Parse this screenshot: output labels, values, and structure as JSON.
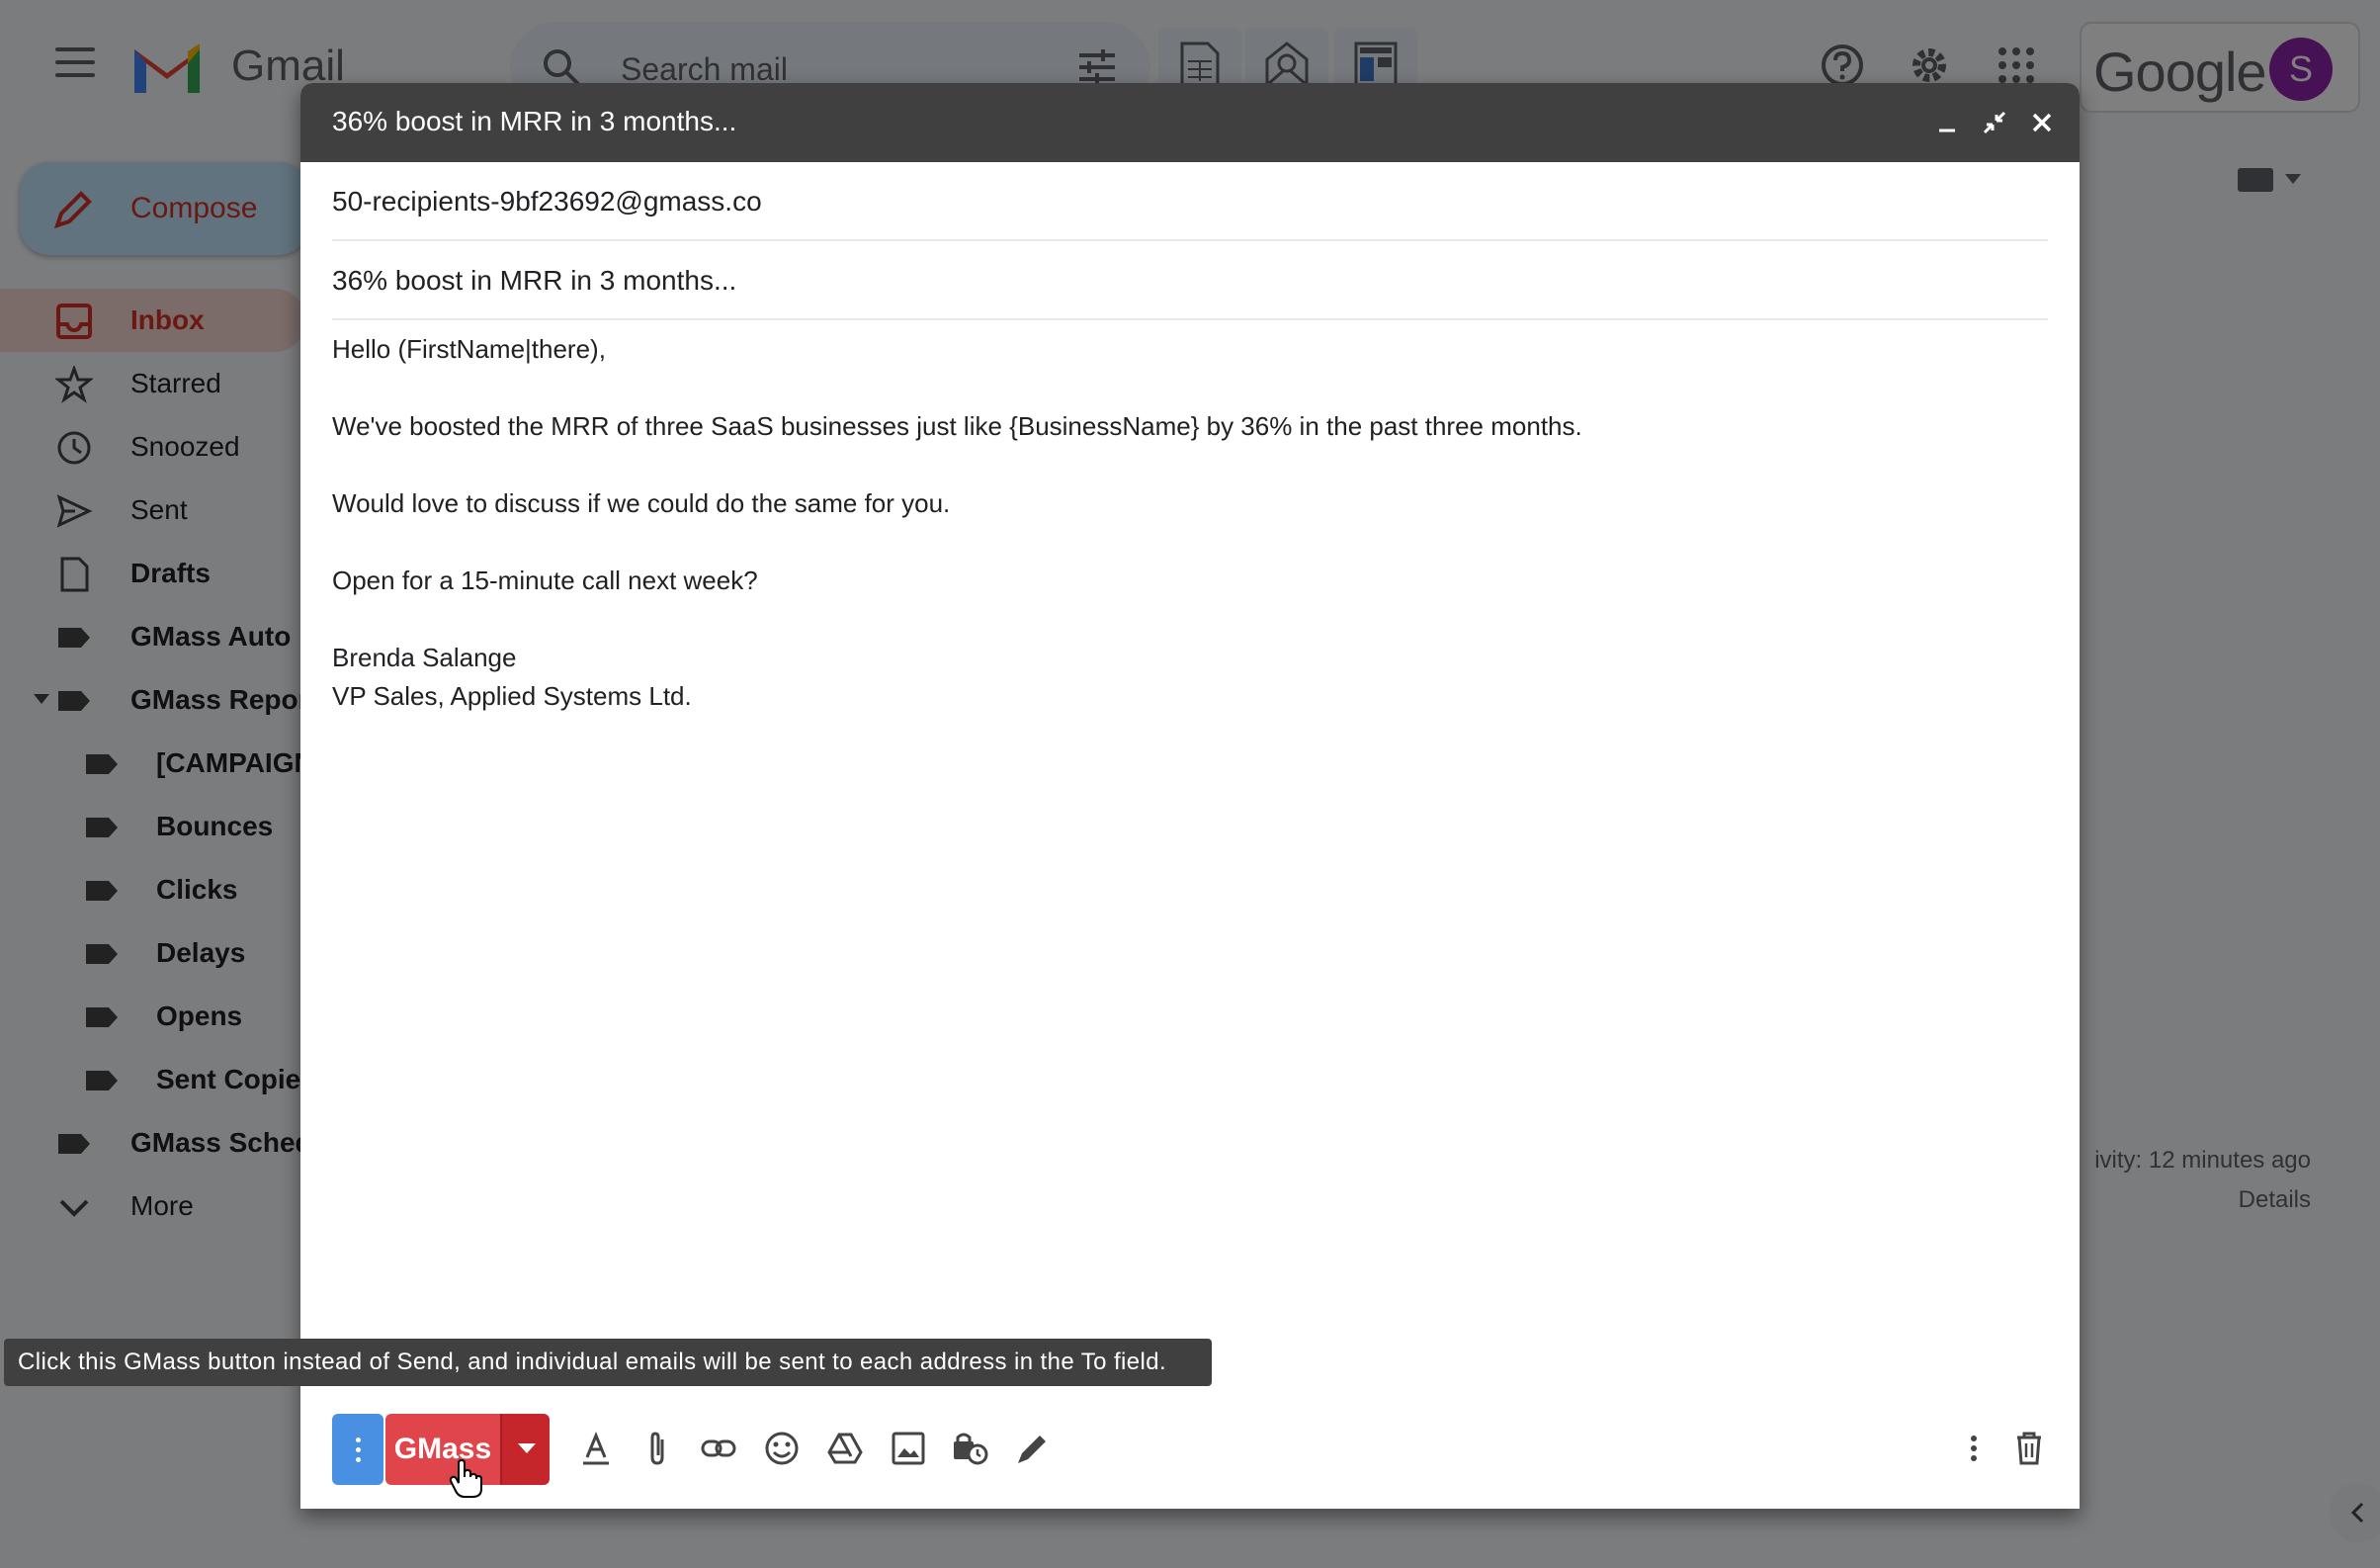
{
  "app": {
    "name": "Gmail",
    "search_placeholder": "Search mail",
    "google_label": "Google",
    "avatar_letter": "S"
  },
  "sidebar": {
    "compose_label": "Compose",
    "items": [
      {
        "label": "Inbox",
        "icon": "inbox-icon"
      },
      {
        "label": "Starred",
        "icon": "star-icon"
      },
      {
        "label": "Snoozed",
        "icon": "clock-icon"
      },
      {
        "label": "Sent",
        "icon": "send-icon"
      },
      {
        "label": "Drafts",
        "icon": "draft-icon"
      },
      {
        "label": "GMass Auto F",
        "icon": "label-icon"
      },
      {
        "label": "GMass Repor",
        "icon": "label-icon"
      },
      {
        "label": "[CAMPAIGN",
        "icon": "label-icon"
      },
      {
        "label": "Bounces",
        "icon": "label-icon"
      },
      {
        "label": "Clicks",
        "icon": "label-icon"
      },
      {
        "label": "Delays",
        "icon": "label-icon"
      },
      {
        "label": "Opens",
        "icon": "label-icon"
      },
      {
        "label": "Sent Copies",
        "icon": "label-icon"
      },
      {
        "label": "GMass Sched",
        "icon": "label-icon"
      },
      {
        "label": "More",
        "icon": "chevron-down-icon"
      }
    ]
  },
  "right_panel": {
    "activity": "ivity: 12 minutes ago",
    "details": "Details"
  },
  "compose": {
    "title": "36% boost in MRR in 3 months...",
    "to": "50-recipients-9bf23692@gmass.co",
    "subject": "36% boost in MRR in 3 months...",
    "body": [
      "Hello (FirstName|there),",
      "",
      "We've boosted the MRR of three SaaS businesses just like {BusinessName} by 36% in the past three months.",
      "",
      "Would love to discuss if we could do the same for you.",
      "",
      "Open for a 15-minute call next week?",
      "",
      "Brenda Salange",
      "VP Sales, Applied Systems Ltd."
    ],
    "gmass_button": "GMass",
    "tooltip": "Click this GMass button instead of Send, and individual emails will be sent to each address in the To field."
  },
  "colors": {
    "gmass_red": "#e0454b",
    "gmass_dark_red": "#c5262b",
    "settings_blue": "#4a90e2",
    "header_dark": "#404040",
    "avatar_purple": "#8e24aa"
  }
}
